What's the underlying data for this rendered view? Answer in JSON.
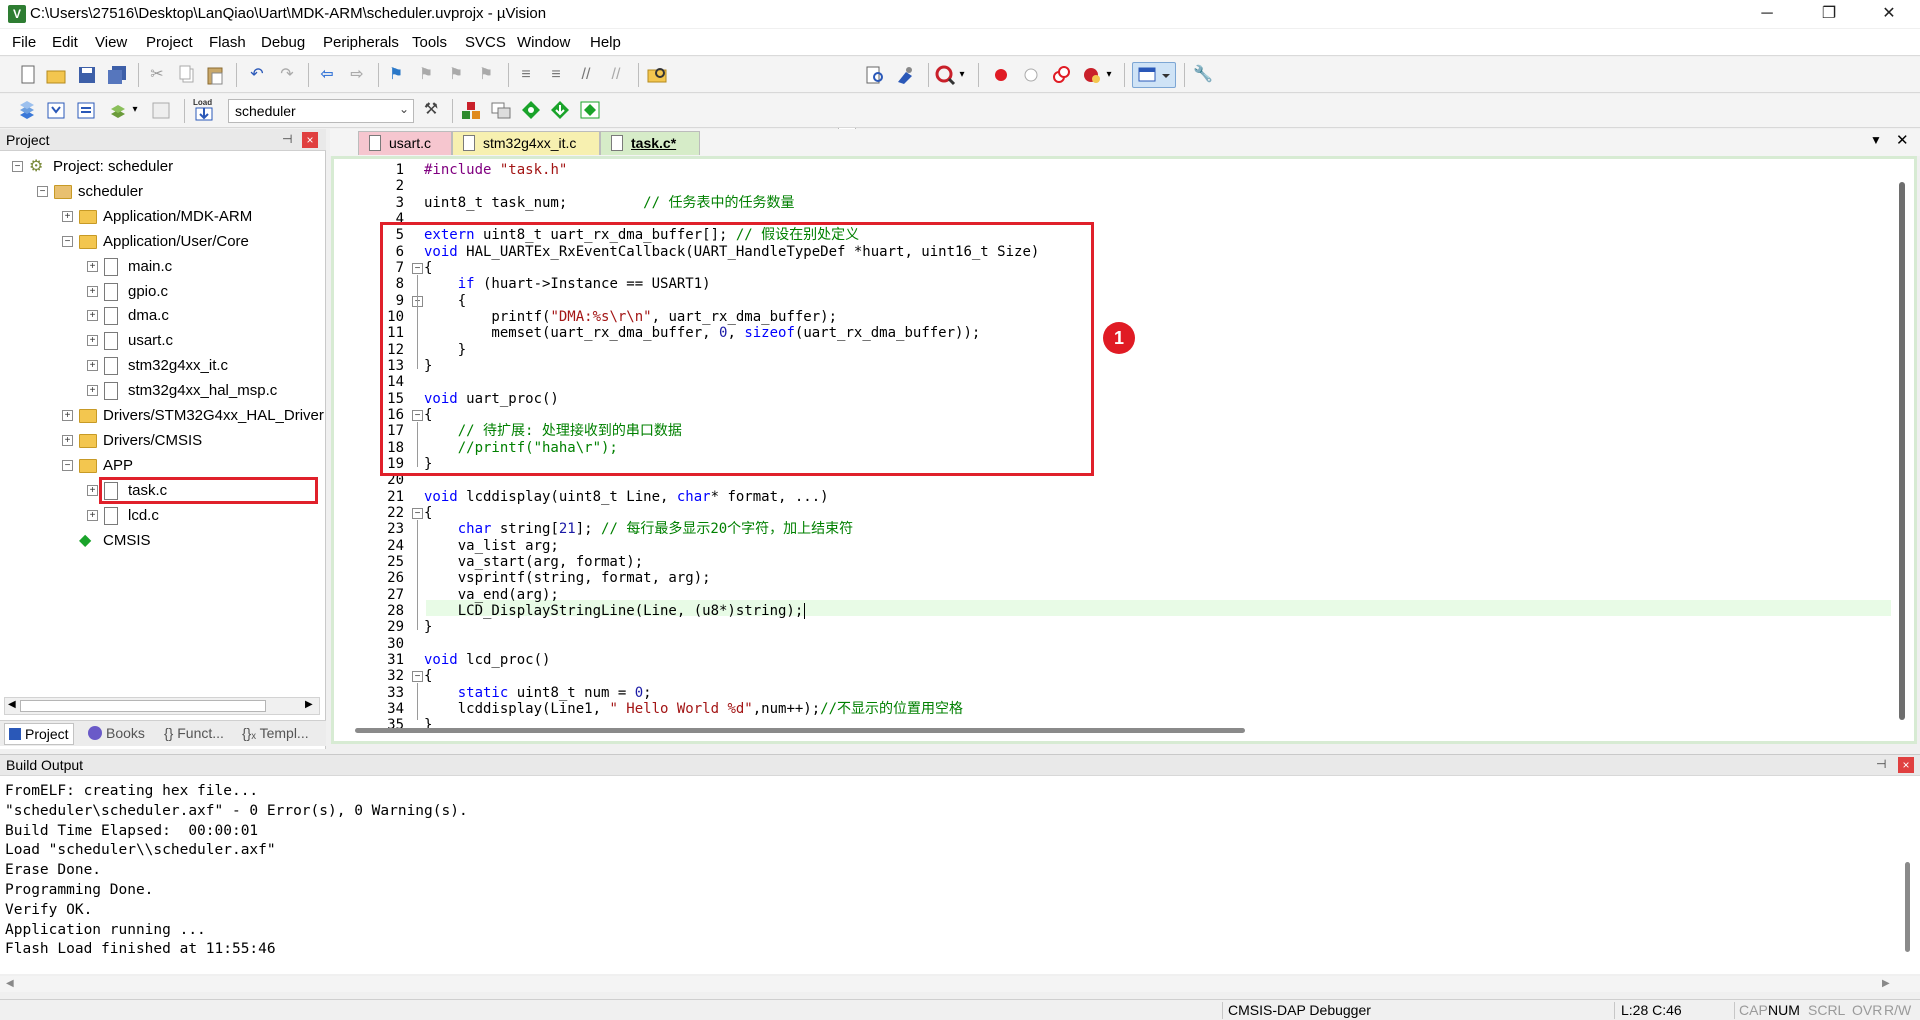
{
  "window": {
    "title": "C:\\Users\\27516\\Desktop\\LanQiao\\Uart\\MDK-ARM\\scheduler.uvprojx - µVision",
    "app_icon": "V",
    "minimize": "─",
    "restore": "❐",
    "close": "✕"
  },
  "menu": [
    "File",
    "Edit",
    "View",
    "Project",
    "Flash",
    "Debug",
    "Peripherals",
    "Tools",
    "SVCS",
    "Window",
    "Help"
  ],
  "toolbar": {
    "target": "scheduler",
    "load_label": "Load"
  },
  "project_panel": {
    "title": "Project",
    "pin": "⊣",
    "close": "×",
    "tree": [
      {
        "label": "Project: scheduler",
        "depth": 0,
        "type": "project",
        "expander": "−"
      },
      {
        "label": "scheduler",
        "depth": 1,
        "type": "target",
        "expander": "−"
      },
      {
        "label": "Application/MDK-ARM",
        "depth": 2,
        "type": "folder",
        "expander": "+"
      },
      {
        "label": "Application/User/Core",
        "depth": 2,
        "type": "folder",
        "expander": "−"
      },
      {
        "label": "main.c",
        "depth": 3,
        "type": "file",
        "expander": "+"
      },
      {
        "label": "gpio.c",
        "depth": 3,
        "type": "file",
        "expander": "+"
      },
      {
        "label": "dma.c",
        "depth": 3,
        "type": "file",
        "expander": "+"
      },
      {
        "label": "usart.c",
        "depth": 3,
        "type": "file",
        "expander": "+"
      },
      {
        "label": "stm32g4xx_it.c",
        "depth": 3,
        "type": "file",
        "expander": "+"
      },
      {
        "label": "stm32g4xx_hal_msp.c",
        "depth": 3,
        "type": "file",
        "expander": "+"
      },
      {
        "label": "Drivers/STM32G4xx_HAL_Driver",
        "depth": 2,
        "type": "folder",
        "expander": "+"
      },
      {
        "label": "Drivers/CMSIS",
        "depth": 2,
        "type": "folder",
        "expander": "+"
      },
      {
        "label": "APP",
        "depth": 2,
        "type": "folder",
        "expander": "−"
      },
      {
        "label": "task.c",
        "depth": 3,
        "type": "file",
        "expander": "+"
      },
      {
        "label": "lcd.c",
        "depth": 3,
        "type": "file",
        "expander": "+"
      },
      {
        "label": "CMSIS",
        "depth": 2,
        "type": "component",
        "expander": ""
      }
    ],
    "tabs": [
      "Project",
      "Books",
      "{} Funct...",
      "{}ₓ Templ..."
    ]
  },
  "editor": {
    "tabs": [
      {
        "label": "usart.c",
        "color": "#f6c6cf"
      },
      {
        "label": "stm32g4xx_it.c",
        "color": "#f7f0b0"
      },
      {
        "label": "task.c*",
        "color": "#d6ecc8"
      }
    ],
    "active_tab": "task.c*",
    "current_line": 28,
    "lines": [
      "#include \"task.h\"",
      "",
      "uint8_t task_num;         // 任务表中的任务数量",
      "",
      "extern uint8_t uart_rx_dma_buffer[]; // 假设在别处定义",
      "void HAL_UARTEx_RxEventCallback(UART_HandleTypeDef *huart, uint16_t Size)",
      "{",
      "    if (huart->Instance == USART1)",
      "    {",
      "        printf(\"DMA:%s\\r\\n\", uart_rx_dma_buffer);",
      "        memset(uart_rx_dma_buffer, 0, sizeof(uart_rx_dma_buffer));",
      "    }",
      "}",
      "",
      "void uart_proc()",
      "{",
      "    // 待扩展: 处理接收到的串口数据",
      "    //printf(\"haha\\r\");",
      "}",
      "",
      "void lcddisplay(uint8_t Line, char* format, ...)",
      "{",
      "    char string[21]; // 每行最多显示20个字符，加上结束符",
      "    va_list arg;",
      "    va_start(arg, format);",
      "    vsprintf(string, format, arg);",
      "    va_end(arg);",
      "    LCD_DisplayStringLine(Line, (u8*)string);",
      "}",
      "",
      "void lcd_proc()",
      "{",
      "    static uint8_t num = 0;",
      "    lcddisplay(Line1, \" Hello World %d\",num++);//不显示的位置用空格",
      "}"
    ],
    "annotation_marker": "1"
  },
  "build_output": {
    "title": "Build Output",
    "lines": [
      "FromELF: creating hex file...",
      "\"scheduler\\scheduler.axf\" - 0 Error(s), 0 Warning(s).",
      "Build Time Elapsed:  00:00:01",
      "Load \"scheduler\\\\scheduler.axf\"",
      "Erase Done.",
      "Programming Done.",
      "Verify OK.",
      "Application running ...",
      "Flash Load finished at 11:55:46"
    ]
  },
  "status": {
    "debugger": "CMSIS-DAP Debugger",
    "position": "L:28 C:46",
    "caps": "CAP",
    "num": "NUM",
    "scrl": "SCRL",
    "ovr": "OVR",
    "rw": "R/W"
  }
}
